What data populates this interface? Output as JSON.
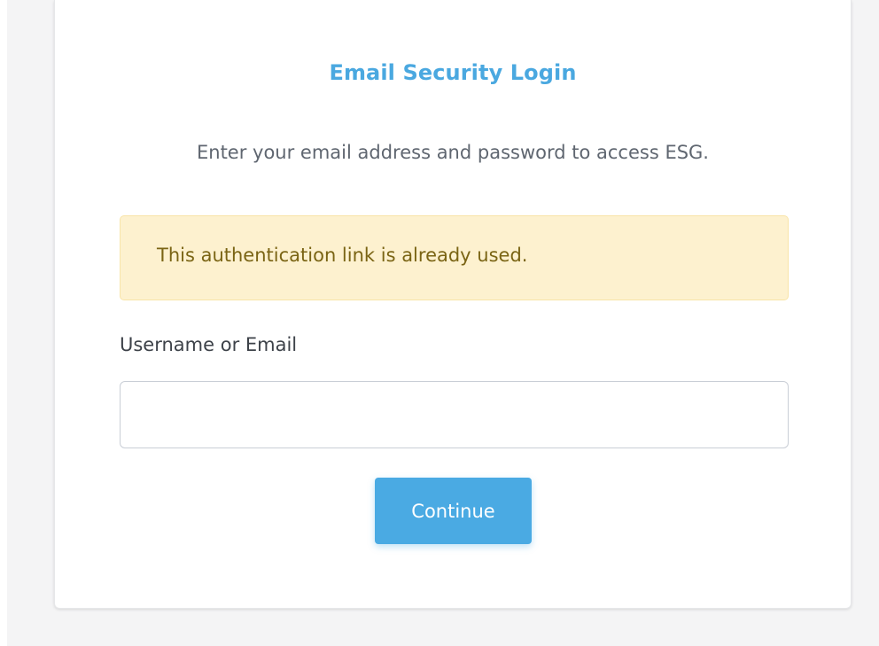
{
  "login": {
    "title": "Email Security Login",
    "subtitle": "Enter your email address and password to access ESG.",
    "alert": {
      "message": "This authentication link is already used.",
      "type": "warning"
    },
    "username_field": {
      "label": "Username or Email",
      "value": "",
      "placeholder": ""
    },
    "continue_label": "Continue"
  },
  "colors": {
    "accent": "#4aaae3",
    "title": "#4aa8e0",
    "alert_background": "#fdf1cf",
    "alert_text": "#7a6414",
    "page_background": "#f4f4f5"
  }
}
